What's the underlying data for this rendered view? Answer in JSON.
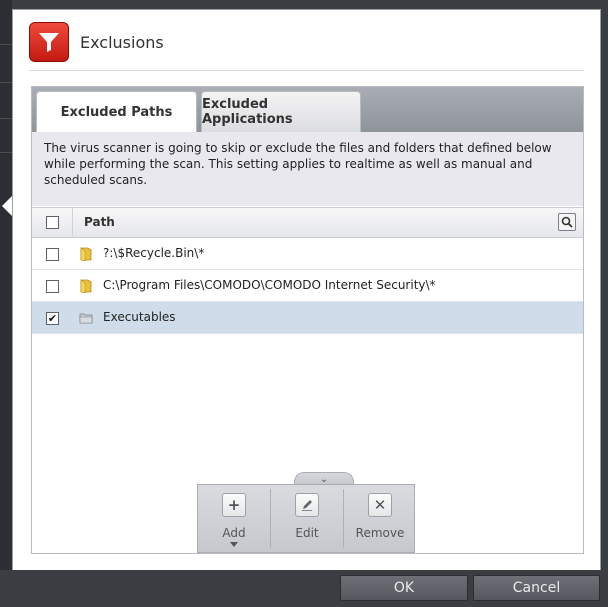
{
  "dialog": {
    "title": "Exclusions"
  },
  "tabs": [
    {
      "label": "Excluded Paths",
      "active": true
    },
    {
      "label": "Excluded Applications",
      "active": false
    }
  ],
  "description": "The virus scanner is going to skip or exclude the files and folders that defined below while performing the scan. This setting applies to realtime as well as manual and scheduled scans.",
  "table": {
    "header": {
      "path_label": "Path",
      "select_all_checked": false
    },
    "rows": [
      {
        "checked": false,
        "icon": "yellow-folder-icon",
        "path": "?:\\$Recycle.Bin\\*"
      },
      {
        "checked": false,
        "icon": "yellow-folder-icon",
        "path": "C:\\Program Files\\COMODO\\COMODO Internet Security\\*"
      },
      {
        "checked": true,
        "icon": "gray-folder-icon",
        "path": "Executables",
        "selected": true
      }
    ]
  },
  "toolbar": {
    "add_label": "Add",
    "edit_label": "Edit",
    "remove_label": "Remove"
  },
  "footer": {
    "ok_label": "OK",
    "cancel_label": "Cancel"
  },
  "colors": {
    "accent_red": "#d9281b",
    "selected_row": "#cfdcea",
    "description_bg": "#eae8ef"
  }
}
